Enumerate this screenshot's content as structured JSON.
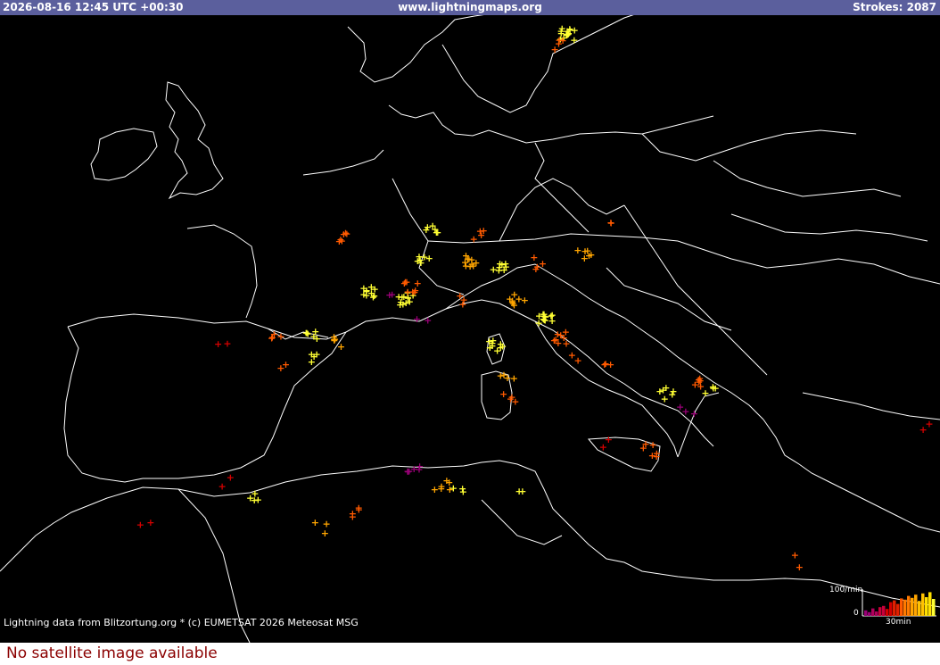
{
  "header": {
    "timestamp": "2026-08-16 12:45 UTC +00:30",
    "site": "www.lightningmaps.org",
    "strokes_label": "Strokes: 2087"
  },
  "credit": "Lightning data from Blitzortung.org  *  (c) EUMETSAT 2026 Meteosat MSG",
  "legend": {
    "rate_label": "100/min",
    "zero_label": "0",
    "window_label": "30min",
    "levels": [
      0.22,
      0.15,
      0.3,
      0.18,
      0.35,
      0.4,
      0.28,
      0.55,
      0.62,
      0.48,
      0.7,
      0.65,
      0.8,
      0.72,
      0.85,
      0.6,
      0.9,
      0.75,
      0.95,
      0.68
    ]
  },
  "footer": {
    "no_satellite": "No satellite image available"
  },
  "colors": {
    "recent": "#ffff33",
    "mid": "#ffa500",
    "older": "#ff5a00",
    "old": "#d40000",
    "oldest": "#9a0077",
    "header_bg": "#5b5f9d"
  },
  "icons": {
    "stroke_marker": "plus-icon"
  }
}
